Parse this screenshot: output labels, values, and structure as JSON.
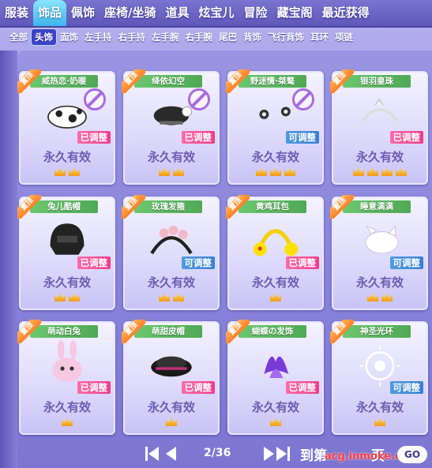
{
  "top_tabs": [
    "服装",
    "饰品",
    "佩饰",
    "座椅/坐骑",
    "道具",
    "炫宝儿",
    "冒险",
    "藏宝阁",
    "最近获得"
  ],
  "top_active": 1,
  "sub_tabs": [
    "全部",
    "头饰",
    "面饰",
    "左手持",
    "右手持",
    "左手腕",
    "右手腕",
    "尾巴",
    "背饰",
    "飞行背饰",
    "耳环",
    "项链"
  ],
  "sub_active": 1,
  "ribbon_label": "置顶",
  "items": [
    {
      "name": "威热恋·奶暖",
      "status": "已调整",
      "status_type": "adjusted",
      "duration": "永久有效",
      "crowns": 2,
      "locked": true
    },
    {
      "name": "绛依幻空",
      "status": "已调整",
      "status_type": "adjusted",
      "duration": "永久有效",
      "crowns": 2,
      "locked": true
    },
    {
      "name": "野迷情·桀骜",
      "status": "可调整",
      "status_type": "adjustable",
      "duration": "永久有效",
      "crowns": 3,
      "locked": true
    },
    {
      "name": "银羽皇珠",
      "status": "已调整",
      "status_type": "adjusted",
      "duration": "永久有效",
      "crowns": 4,
      "locked": false
    },
    {
      "name": "兔儿酷帽",
      "status": "已调整",
      "status_type": "adjusted",
      "duration": "永久有效",
      "crowns": 2,
      "locked": false
    },
    {
      "name": "玫瑰发箍",
      "status": "可调整",
      "status_type": "adjustable",
      "duration": "永久有效",
      "crowns": 2,
      "locked": false
    },
    {
      "name": "黄鸡耳包",
      "status": "已调整",
      "status_type": "adjusted",
      "duration": "永久有效",
      "crowns": 1,
      "locked": false
    },
    {
      "name": "睡意满满",
      "status": "可调整",
      "status_type": "adjustable",
      "duration": "永久有效",
      "crowns": 2,
      "locked": false
    },
    {
      "name": "萌动白兔",
      "status": "已调整",
      "status_type": "adjusted",
      "duration": "永久有效",
      "crowns": 1,
      "locked": false
    },
    {
      "name": "萌甜皮帽",
      "status": "已调整",
      "status_type": "adjusted",
      "duration": "永久有效",
      "crowns": 1,
      "locked": false
    },
    {
      "name": "蝴蝶の发饰",
      "status": "已调整",
      "status_type": "adjusted",
      "duration": "永久有效",
      "crowns": 1,
      "locked": false
    },
    {
      "name": "神圣光环",
      "status": "可调整",
      "status_type": "adjustable",
      "duration": "永久有效",
      "crowns": 1,
      "locked": false
    }
  ],
  "pager": {
    "page": "2/36",
    "goto_label": "到第",
    "page_unit": "页",
    "go_label": "GO"
  },
  "watermark": "acg.inmoke.com",
  "colors": {
    "adjusted": "#ee3c8a",
    "adjustable": "#3a7fd2",
    "ribbon": "#ff7f24",
    "name_bg": "#4fa955"
  }
}
